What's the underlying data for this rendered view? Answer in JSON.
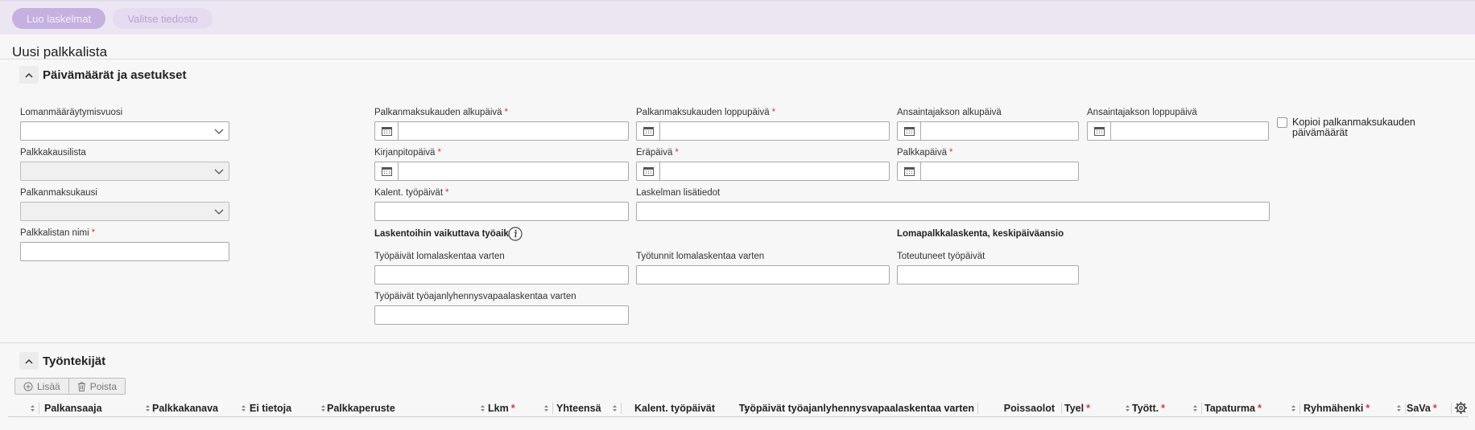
{
  "toolbar_top": {
    "create_label": "Luo laskelmat",
    "file_label": "Valitse tiedosto"
  },
  "page_title": "Uusi palkkalista",
  "sections": {
    "dates_title": "Päivämäärät ja asetukset",
    "employees_title": "Työntekijät"
  },
  "form": {
    "holiday_year_label": "Lomanmääräytymisvuosi",
    "holiday_year_value": "",
    "pay_period_list_label": "Palkkakausilista",
    "pay_period_list_value": "",
    "pay_period_label": "Palkanmaksukausi",
    "pay_period_value": "",
    "list_name_label": "Palkkalistan nimi",
    "list_name_value": "",
    "period_start_label": "Palkanmaksukauden alkupäivä",
    "period_end_label": "Palkanmaksukauden loppupäivä",
    "earning_start_label": "Ansaintajakson alkupäivä",
    "earning_end_label": "Ansaintajakson loppupäivä",
    "copy_dates_label": "Kopioi palkanmaksukauden päivämäärät",
    "booking_date_label": "Kirjanpitopäivä",
    "due_date_label": "Eräpäivä",
    "pay_date_label": "Palkkapäivä",
    "calendar_days_label": "Kalent. työpäivät",
    "extra_info_label": "Laskelman lisätiedot",
    "worktime_header": "Laskentoihin vaikuttava työaika",
    "holiday_header": "Lomapalkkalaskenta, keskipäiväansio",
    "workdays_holiday_label": "Työpäivät lomalaskentaa varten",
    "workhours_holiday_label": "Työtunnit lomalaskentaa varten",
    "actual_workdays_label": "Toteutuneet työpäivät",
    "reduction_days_label": "Työpäivät työajanlyhennysvapaalaskentaa varten"
  },
  "employees_toolbar": {
    "add_label": "Lisää",
    "remove_label": "Poista"
  },
  "grid_columns": [
    {
      "label": "Palkansaaja",
      "required": false
    },
    {
      "label": "Palkkakanava",
      "required": false
    },
    {
      "label": "Ei tietoja",
      "required": false
    },
    {
      "label": "Palkkaperuste",
      "required": false
    },
    {
      "label": "Lkm",
      "required": true
    },
    {
      "label": "Yhteensä",
      "required": false
    },
    {
      "label": "Kalent. työpäivät",
      "required": false
    },
    {
      "label": "Työpäivät työajanlyhennysvapaalaskentaa varten",
      "required": false
    },
    {
      "label": "Poissaolot",
      "required": false
    },
    {
      "label": "Tyel",
      "required": true
    },
    {
      "label": "Tyött.",
      "required": true
    },
    {
      "label": "Tapaturma",
      "required": true
    },
    {
      "label": "Ryhmähenki",
      "required": true
    },
    {
      "label": "SaVa",
      "required": true
    }
  ],
  "required_mark": "*",
  "colors": {
    "accent": "#c5b0e0",
    "topbar": "#ece6f3",
    "required": "#dd3333"
  },
  "icons": [
    "chevron-up-icon",
    "chevron-down-icon",
    "calendar-icon",
    "info-icon",
    "plus-circle-icon",
    "trash-icon",
    "sort-icon",
    "gear-icon"
  ]
}
